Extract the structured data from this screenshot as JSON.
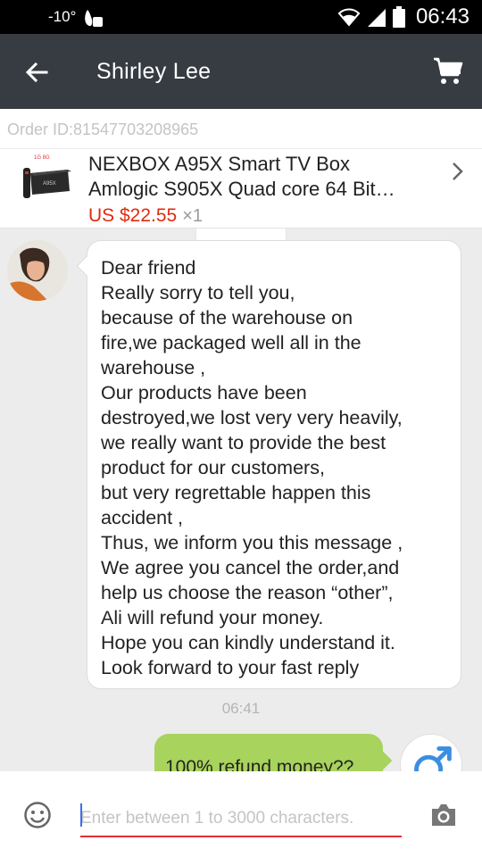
{
  "status_bar": {
    "temperature": "-10°",
    "time": "06:43"
  },
  "header": {
    "title": "Shirley Lee",
    "icons": [
      "back-arrow-icon",
      "shopping-cart-icon"
    ]
  },
  "order": {
    "order_id": "Order ID:81547703208965",
    "product_name_line1": "NEXBOX A95X Smart TV Box",
    "product_name_line2": "Amlogic S905X Quad core 64 Bit…",
    "price": "US $22.55",
    "quantity": "×1",
    "thumb_label": "1G 8G",
    "thumb_brand": "A95X"
  },
  "messages": [
    {
      "from": "seller",
      "lines": [
        "Dear friend",
        "Really sorry to tell you,",
        "because of the warehouse on",
        "fire,we packaged well all in the",
        "warehouse ,",
        "Our products have been",
        "destroyed,we lost very very heavily,",
        "we really want to provide the best",
        "product for our customers,",
        "but very regrettable happen this",
        "accident ,",
        "Thus, we inform you this message ,",
        "We agree you cancel the order,and",
        "help us choose the reason “other”,",
        "Ali will refund your money.",
        "Hope you can kindly understand it.",
        "Look forward to your fast reply"
      ]
    }
  ],
  "timestamp": "06:41",
  "my_message": "100% refund money??",
  "composer": {
    "placeholder": "Enter between 1 to 3000 characters.",
    "value": ""
  },
  "colors": {
    "appbar": "#373c42",
    "price": "#e02b0f",
    "my_bubble": "#a8d35c",
    "input_underline": "#e0303a"
  }
}
